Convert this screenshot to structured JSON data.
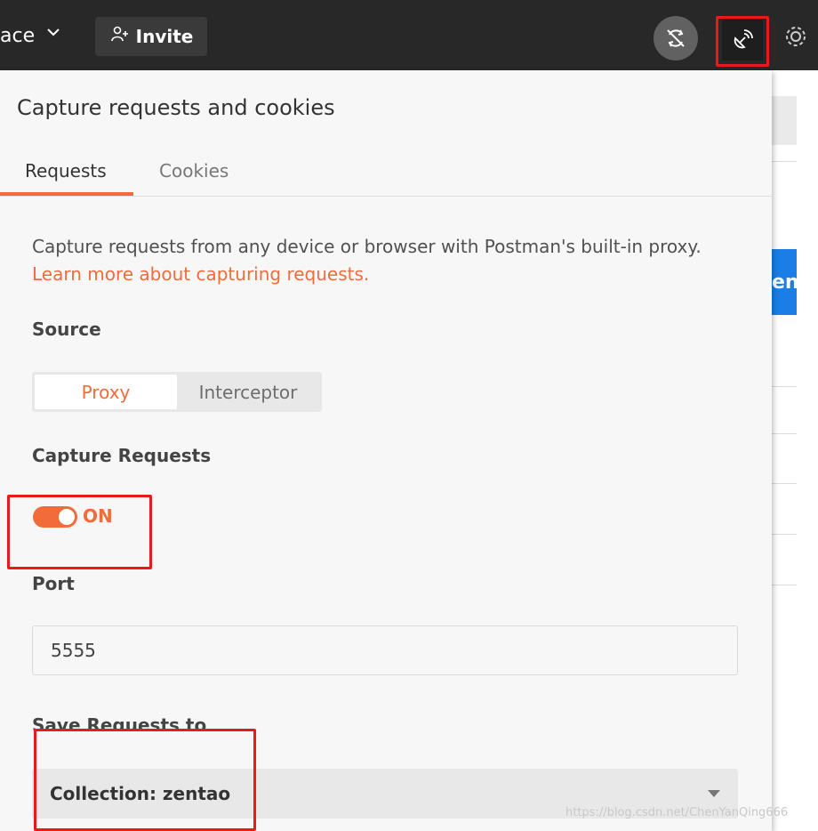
{
  "topbar": {
    "workspace_label": "ace",
    "invite_label": "Invite",
    "icons": [
      "chevron-down-icon",
      "add-user-icon",
      "sync-off-icon",
      "capture-satellite-icon",
      "gear-icon"
    ]
  },
  "panel": {
    "title": "Capture requests and cookies",
    "tabs": [
      {
        "label": "Requests",
        "active": true
      },
      {
        "label": "Cookies",
        "active": false
      }
    ],
    "description": "Capture requests from any device or browser with Postman's built-in proxy.",
    "learn_more_link": "Learn more about capturing requests.",
    "source_label": "Source",
    "source_options": [
      {
        "label": "Proxy",
        "selected": true
      },
      {
        "label": "Interceptor",
        "selected": false
      }
    ],
    "capture_requests_label": "Capture Requests",
    "capture_toggle_text": "ON",
    "port_label": "Port",
    "port_value": "5555",
    "save_requests_label": "Save Requests to",
    "save_requests_value": "Collection: zentao"
  },
  "background_app": {
    "button_fragment": "en"
  },
  "watermark": "https://blog.csdn.net/ChenYanQing666",
  "colors": {
    "accent": "#f26b3a",
    "topbar": "#282828",
    "highlight_box": "#ea1a1a",
    "bg_button": "#1a7ee6"
  }
}
